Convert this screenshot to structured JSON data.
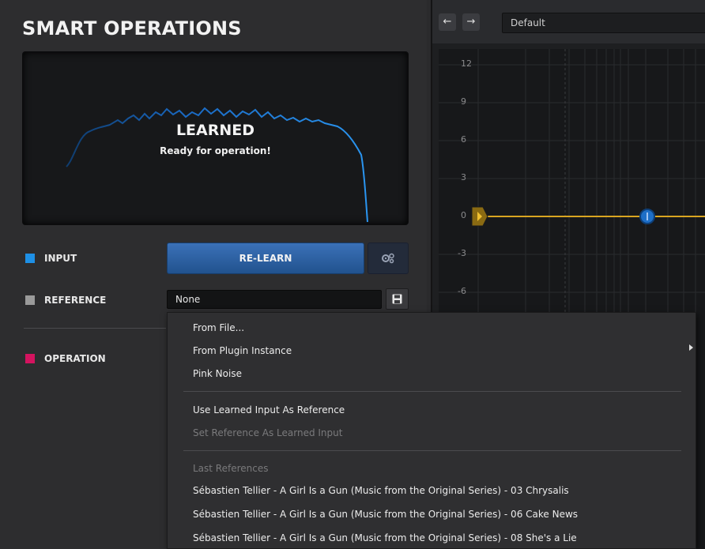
{
  "panel": {
    "title": "SMART OPERATIONS",
    "status_title": "LEARNED",
    "status_sub": "Ready for operation!"
  },
  "rows": {
    "input_label": "INPUT",
    "input_color": "#1e90e6",
    "reference_label": "REFERENCE",
    "reference_color": "#9a9a9a",
    "operation_label": "OPERATION",
    "operation_color": "#d4135f"
  },
  "controls": {
    "relearn_label": "RE-LEARN",
    "reference_value": "None"
  },
  "toolbar": {
    "back_icon": "arrow-left",
    "forward_icon": "arrow-right",
    "preset_value": "Default"
  },
  "graph": {
    "y_ticks": [
      "12",
      "9",
      "6",
      "3",
      "0",
      "-3",
      "-6"
    ],
    "accent_color": "#d9a520",
    "node_color": "#1e6fc8"
  },
  "menu": {
    "items": [
      "From File...",
      "From Plugin Instance",
      "Pink Noise",
      "Use Learned Input As Reference",
      "Set Reference As Learned Input"
    ],
    "last_references_header": "Last References",
    "last_references": [
      "Sébastien Tellier - A Girl Is a Gun (Music from the Original Series) - 03 Chrysalis",
      "Sébastien Tellier - A Girl Is a Gun (Music from the Original Series) - 06 Cake News",
      "Sébastien Tellier - A Girl Is a Gun (Music from the Original Series) - 08 She's a Lie"
    ]
  }
}
